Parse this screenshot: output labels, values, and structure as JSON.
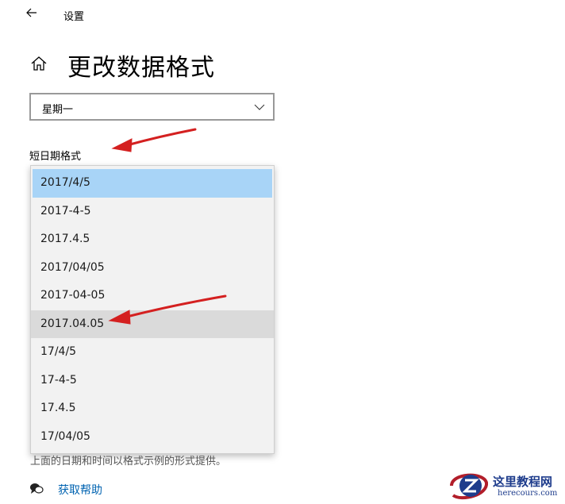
{
  "window": {
    "title": "设置"
  },
  "page": {
    "title": "更改数据格式"
  },
  "first_day_select": {
    "value": "星期一"
  },
  "short_date": {
    "label": "短日期格式",
    "options": [
      {
        "label": "2017/4/5",
        "state": "selected"
      },
      {
        "label": "2017-4-5",
        "state": ""
      },
      {
        "label": "2017.4.5",
        "state": ""
      },
      {
        "label": "2017/04/05",
        "state": ""
      },
      {
        "label": "2017-04-05",
        "state": ""
      },
      {
        "label": "2017.04.05",
        "state": "hover"
      },
      {
        "label": "17/4/5",
        "state": ""
      },
      {
        "label": "17-4-5",
        "state": ""
      },
      {
        "label": "17.4.5",
        "state": ""
      },
      {
        "label": "17/04/05",
        "state": ""
      }
    ]
  },
  "footnote": "上面的日期和时间以格式示例的形式提供。",
  "help": {
    "label": "获取帮助"
  },
  "watermark": {
    "title": "这里教程网",
    "url": "herecours.com"
  },
  "colors": {
    "selected_bg": "#a8d4f7",
    "hover_bg": "#dadada",
    "link": "#0063b1",
    "annotation_arrow": "#d42020"
  }
}
